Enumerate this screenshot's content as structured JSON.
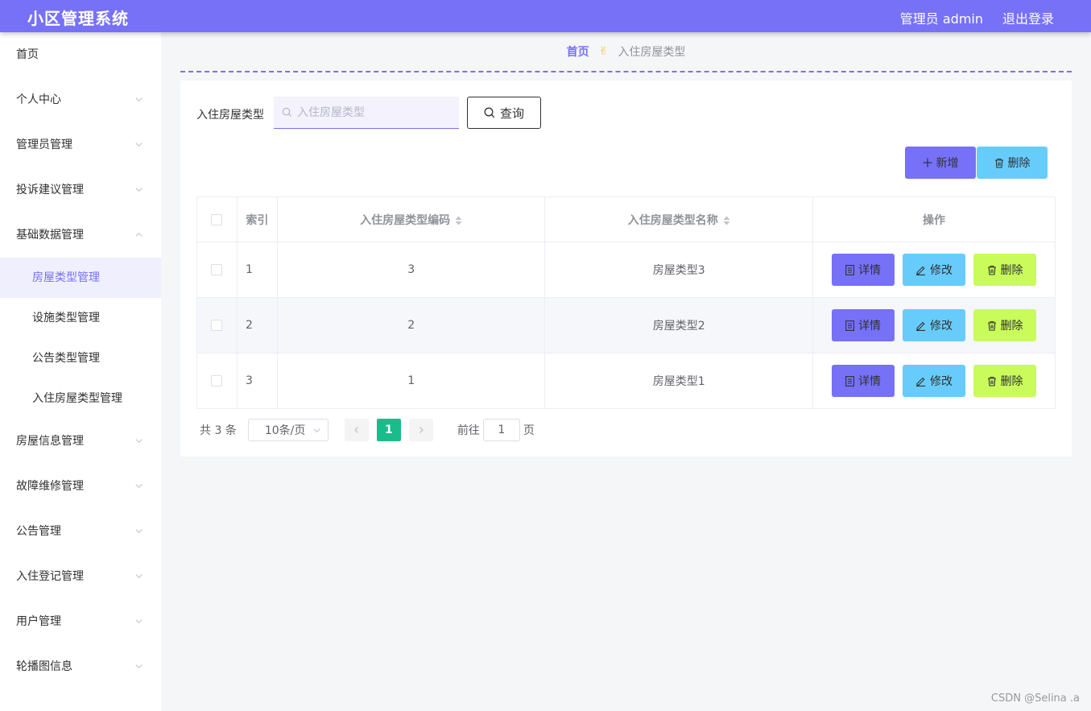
{
  "app": {
    "title": "小区管理系统",
    "admin_label": "管理员 admin",
    "logout_label": "退出登录"
  },
  "colors": {
    "primary": "#7671f7",
    "info": "#67ccfb",
    "lime": "#c9fb5b",
    "pager_active": "#1abc8c"
  },
  "sidebar": {
    "items": [
      {
        "label": "首页"
      },
      {
        "label": "个人中心"
      },
      {
        "label": "管理员管理"
      },
      {
        "label": "投诉建议管理"
      },
      {
        "label": "基础数据管理"
      },
      {
        "label": "房屋信息管理"
      },
      {
        "label": "故障维修管理"
      },
      {
        "label": "公告管理"
      },
      {
        "label": "入住登记管理"
      },
      {
        "label": "用户管理"
      },
      {
        "label": "轮播图信息"
      }
    ],
    "sub_items": [
      {
        "label": "房屋类型管理",
        "active": true
      },
      {
        "label": "设施类型管理"
      },
      {
        "label": "公告类型管理"
      },
      {
        "label": "入住房屋类型管理"
      }
    ]
  },
  "breadcrumb": {
    "home": "首页",
    "separator": "✌",
    "current": "入住房屋类型"
  },
  "search": {
    "label": "入住房屋类型",
    "placeholder": "入住房屋类型",
    "button_label": "查询"
  },
  "toolbar": {
    "add_label": "新增",
    "delete_label": "删除"
  },
  "table": {
    "headers": {
      "index": "索引",
      "code": "入住房屋类型编码",
      "name": "入住房屋类型名称",
      "ops": "操作"
    },
    "rows": [
      {
        "index": "1",
        "code": "3",
        "name": "房屋类型3"
      },
      {
        "index": "2",
        "code": "2",
        "name": "房屋类型2"
      },
      {
        "index": "3",
        "code": "1",
        "name": "房屋类型1"
      }
    ],
    "ops": {
      "detail": "详情",
      "edit": "修改",
      "remove": "删除"
    }
  },
  "pager": {
    "total": "共 3 条",
    "page_size": "10条/页",
    "current": "1",
    "goto_prefix": "前往",
    "goto_value": "1",
    "goto_suffix": "页"
  },
  "watermark": "CSDN @Selina .a"
}
